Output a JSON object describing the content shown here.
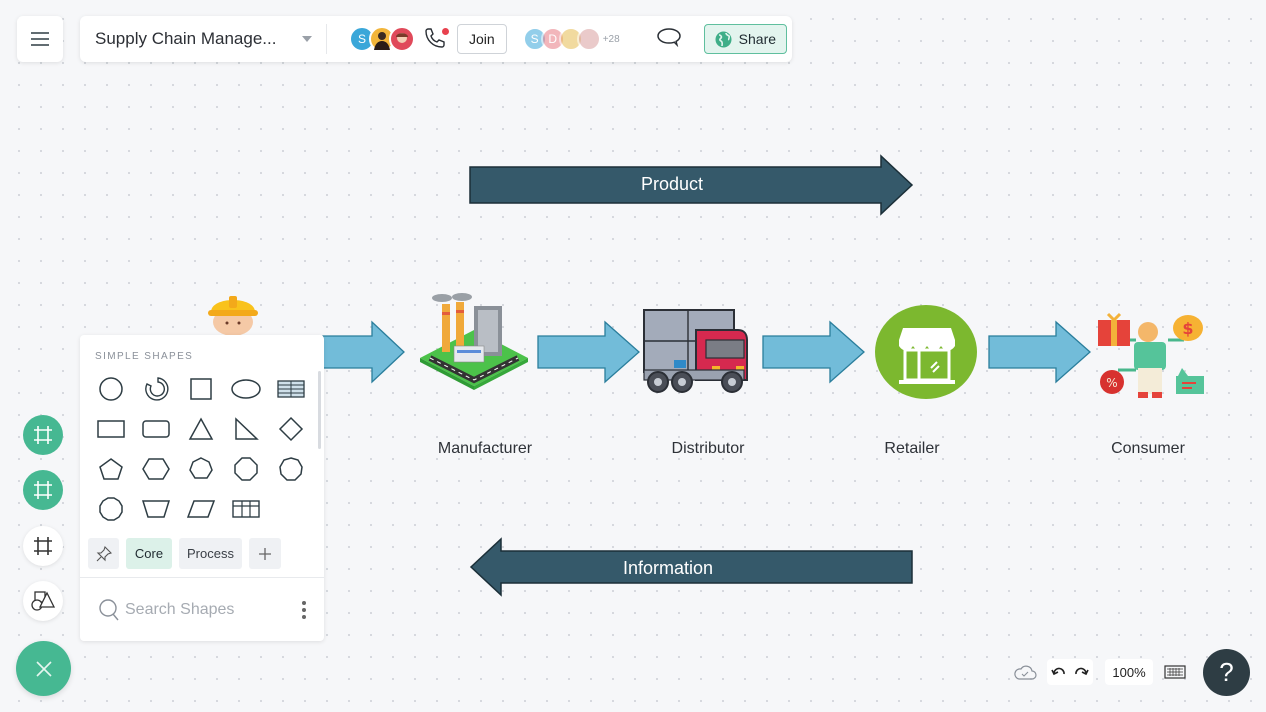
{
  "topbar": {
    "doc_title": "Supply Chain Manage...",
    "collaborators": [
      {
        "initial": "S",
        "color": "#3aa7d9"
      },
      {
        "initial": "",
        "color": "#f2b53a"
      },
      {
        "initial": "",
        "color": "#e0495a"
      }
    ],
    "join_label": "Join",
    "viewers": [
      {
        "initial": "S",
        "color": "#3aa7d9"
      },
      {
        "initial": "D",
        "color": "#e97b85"
      },
      {
        "initial": "",
        "color": "#e6bd52"
      },
      {
        "initial": "",
        "color": "#d9a0a0"
      }
    ],
    "viewers_more": "+28",
    "share_label": "Share"
  },
  "diagram": {
    "top_arrow_label": "Product",
    "bottom_arrow_label": "Information",
    "nodes": [
      {
        "label": "",
        "icon": "worker-icon"
      },
      {
        "label": "Manufacturer",
        "icon": "factory-icon"
      },
      {
        "label": "Distributor",
        "icon": "truck-icon"
      },
      {
        "label": "Retailer",
        "icon": "store-icon"
      },
      {
        "label": "Consumer",
        "icon": "consumer-icon"
      }
    ],
    "colors": {
      "big_arrow": "#35596a",
      "flow_arrow": "#72bcd9",
      "retailer_circle": "#7cb82f"
    }
  },
  "shapes_panel": {
    "heading": "SIMPLE SHAPES",
    "shapes": [
      "circle",
      "arc",
      "square",
      "ellipse",
      "table",
      "rectangle",
      "rounded-rectangle",
      "triangle",
      "right-triangle",
      "diamond",
      "pentagon",
      "hexagon",
      "heptagon",
      "octagon",
      "nonagon",
      "decagon",
      "trapezoid",
      "parallelogram",
      "grid-table"
    ],
    "tabs": [
      {
        "label": "Core",
        "active": true
      },
      {
        "label": "Process",
        "active": false
      }
    ],
    "search_placeholder": "Search Shapes"
  },
  "bottom_bar": {
    "zoom_level": "100%",
    "help_label": "?"
  },
  "accent_color": "#46b892"
}
